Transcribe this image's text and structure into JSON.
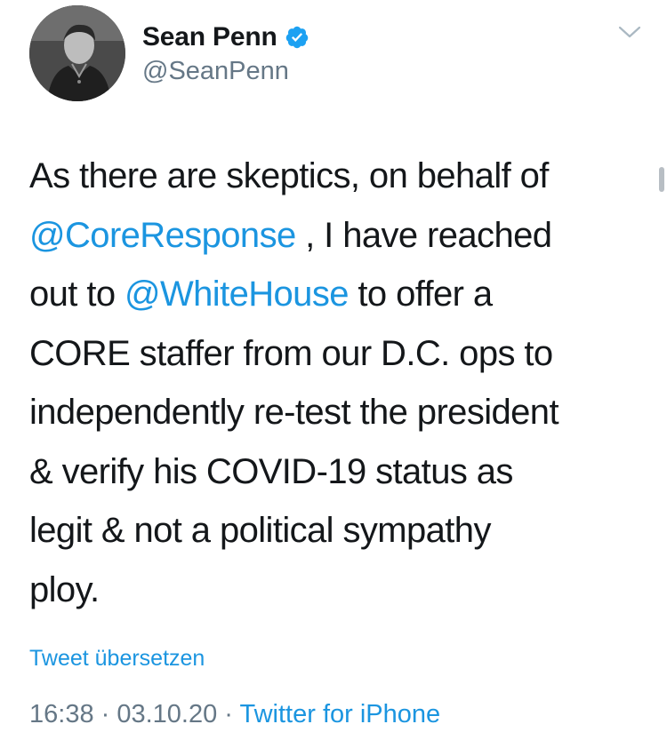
{
  "user": {
    "display_name": "Sean Penn",
    "handle": "@SeanPenn",
    "verified": true,
    "avatar_icon": "avatar-photo"
  },
  "menu": {
    "icon": "chevron-down-icon"
  },
  "tweet": {
    "lines": [
      [
        "As there are skeptics, on behalf of"
      ],
      [
        "@CoreResponse",
        " , I have reached"
      ],
      [
        "out to ",
        "@WhiteHouse",
        " to offer a"
      ],
      [
        "CORE staffer from our D.C. ops to"
      ],
      [
        "independently re-test the president"
      ],
      [
        "& verify his COVID-19 status as"
      ],
      [
        "legit & not a political sympathy"
      ],
      [
        "ploy."
      ]
    ]
  },
  "translate_label": "Tweet übersetzen",
  "meta": {
    "time": "16:38",
    "sep1": " · ",
    "date": "03.10.20",
    "sep2": " · ",
    "source": "Twitter for iPhone"
  },
  "colors": {
    "link": "#1b95e0",
    "text": "#14171a",
    "secondary": "#657786",
    "verified": "#1da1f2"
  }
}
